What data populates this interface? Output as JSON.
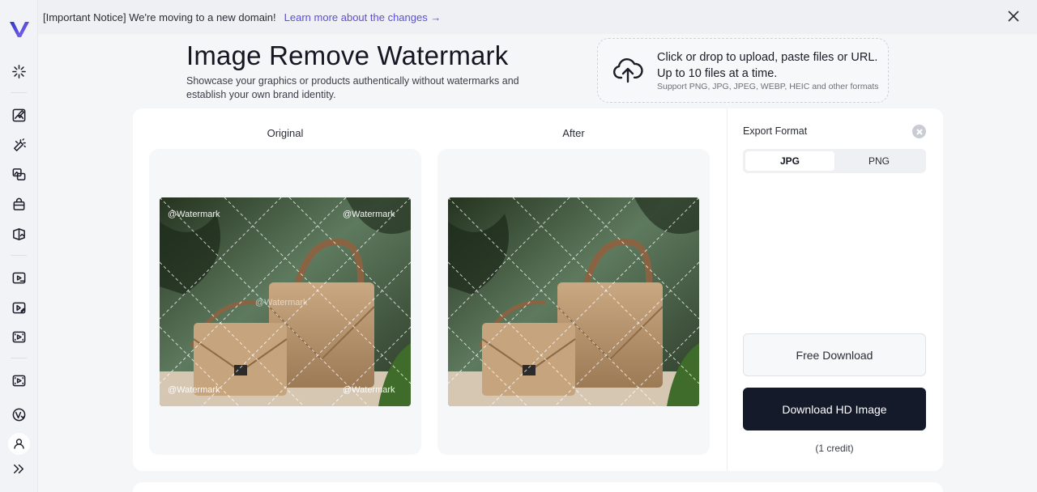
{
  "notice": {
    "text": "[Important Notice] We're moving to a new domain!",
    "link": "Learn more about the changes →"
  },
  "header": {
    "title": "Image Remove Watermark",
    "subtitle": "Showcase your graphics or products authentically without watermarks and establish your own brand identity."
  },
  "upload": {
    "line1": "Click or drop to upload, paste files or URL.",
    "line2": "Up to 10 files at a time.",
    "line3": "Support PNG, JPG, JPEG, WEBP, HEIC and other formats"
  },
  "compare": {
    "original_label": "Original",
    "after_label": "After",
    "watermark_text": "@Watermark"
  },
  "export": {
    "label": "Export Format",
    "options": [
      "JPG",
      "PNG"
    ],
    "selected": "JPG"
  },
  "actions": {
    "free_download": "Free Download",
    "hd_download": "Download HD Image",
    "credit_note": "(1 credit)"
  },
  "colors": {
    "accent": "#5b4fd6",
    "primary_button": "#141a2a",
    "logo_gradient_start": "#3a3bd6",
    "logo_gradient_end": "#8a6cf0"
  },
  "sidebar": {
    "icons": [
      "sparkle-icon",
      "image-edit-icon",
      "magic-wand-icon",
      "image-swap-icon",
      "bag-icon",
      "split-image-icon",
      "video-play-icon",
      "video-edit-icon",
      "video-film-icon",
      "video-enhance-icon",
      "brand-badge-icon",
      "user-icon",
      "expand-icon"
    ]
  }
}
